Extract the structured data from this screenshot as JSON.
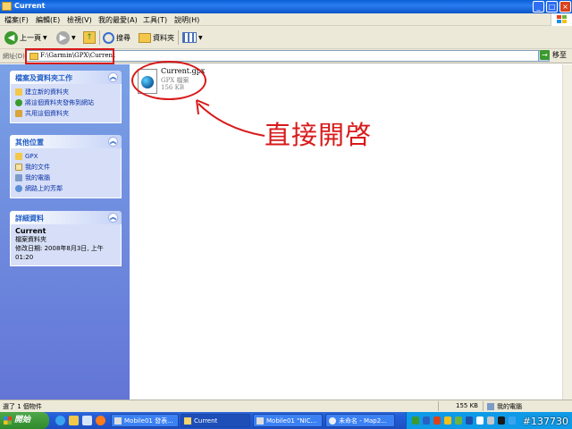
{
  "window": {
    "title": "Current"
  },
  "menu": [
    "檔案(F)",
    "編輯(E)",
    "檢視(V)",
    "我的最愛(A)",
    "工具(T)",
    "說明(H)"
  ],
  "toolbar": {
    "back": "上一頁",
    "search": "搜尋",
    "folders": "資料夾"
  },
  "address": {
    "label": "網址(D)",
    "value": "F:\\Garmin\\GPX\\Current",
    "go": "移至"
  },
  "left_pane": {
    "tasks": {
      "title": "檔案及資料夾工作",
      "items": [
        "建立新的資料夾",
        "將這個資料夾發佈到網站",
        "共用這個資料夾"
      ]
    },
    "places": {
      "title": "其他位置",
      "items": [
        "GPX",
        "我的文件",
        "我的電腦",
        "網路上的芳鄰"
      ]
    },
    "details": {
      "title": "詳細資料",
      "name": "Current",
      "type": "檔案資料夾",
      "modified_line1": "修改日期: 2008年8月3日, 上午",
      "modified_line2": "01:20"
    }
  },
  "file": {
    "name": "Current.gpx",
    "type": "GPX 檔案",
    "size": "156 KB"
  },
  "annotation": "直接開啓",
  "status": {
    "selected": "選了 1 個物件",
    "size": "155 KB",
    "location": "我的電腦"
  },
  "taskbar": {
    "start": "開始",
    "buttons": [
      "Mobile01 發表...",
      "Current",
      "Mobile01 \"NIC...",
      "未命名 - Map2..."
    ],
    "watermark": "#137730"
  },
  "colors": {
    "annotation_red": "#d81a1a",
    "titlebar_blue": "#0a5fd6",
    "left_pane_blue": "#7aa1e6"
  }
}
